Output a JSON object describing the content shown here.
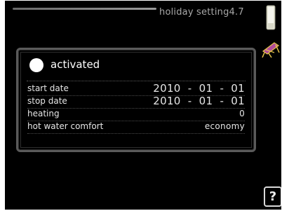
{
  "header": {
    "title": "holiday setting4.7"
  },
  "icons": {
    "thermometer": "thermometer-icon",
    "deckchair": "deckchair-icon",
    "help": "help-icon",
    "help_glyph": "?"
  },
  "panel": {
    "activated_label": "activated",
    "rows": [
      {
        "label": "start date",
        "value": "2010  -  01  -  01"
      },
      {
        "label": "stop date",
        "value": "2010  -  01  -  01"
      },
      {
        "label": "heating",
        "value": "0"
      },
      {
        "label": "hot water comfort",
        "value": "economy"
      }
    ]
  },
  "colors": {
    "background": "#000000",
    "text": "#ffffff",
    "title": "#a8a8a8",
    "panel_border": "#5a5a5a",
    "deckchair": "#b04a9a"
  }
}
